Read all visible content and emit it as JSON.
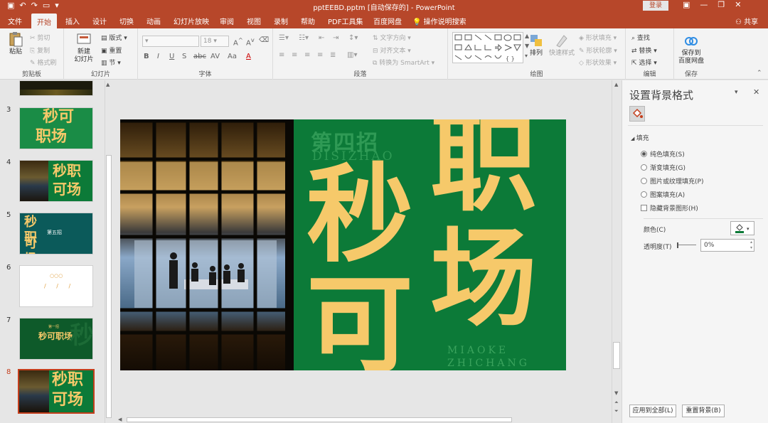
{
  "titlebar": {
    "title": "pptEEBD.pptm [自动保存的] - PowerPoint",
    "login": "登录",
    "qa_icons": [
      "save-icon",
      "undo-icon",
      "redo-icon",
      "start-slideshow-icon",
      "customize-icon"
    ],
    "window_buttons": [
      "—",
      "❐",
      "✕"
    ]
  },
  "tabs": [
    "文件",
    "开始",
    "插入",
    "设计",
    "切换",
    "动画",
    "幻灯片放映",
    "审阅",
    "视图",
    "录制",
    "帮助",
    "PDF工具集",
    "百度网盘"
  ],
  "active_tab": "开始",
  "tell_me": "操作说明搜索",
  "share": "共享",
  "ribbon": {
    "clipboard": {
      "label": "剪贴板",
      "paste": "粘贴",
      "cut": "剪切",
      "copy": "复制",
      "format_painter": "格式刷"
    },
    "slides": {
      "label": "幻灯片",
      "new_slide_1": "新建",
      "new_slide_2": "幻灯片",
      "layout": "版式",
      "reset": "重置",
      "section": "节"
    },
    "font": {
      "label": "字体",
      "size": "18",
      "bold": "B",
      "italic": "I",
      "underline": "U",
      "strike": "S",
      "shadow": "abc",
      "spacing": "AV",
      "case": "Aa",
      "color": "A"
    },
    "paragraph": {
      "label": "段落",
      "text_direction": "文字方向",
      "align_text": "对齐文本",
      "smartart": "转换为 SmartArt"
    },
    "drawing": {
      "label": "绘图",
      "arrange": "排列",
      "quick_styles": "快速样式",
      "shape_fill": "形状填充",
      "shape_outline": "形状轮廓",
      "shape_effects": "形状效果"
    },
    "editing": {
      "label": "编辑",
      "find": "查找",
      "replace": "替换",
      "select": "选择"
    },
    "save": {
      "label": "保存",
      "save_to_1": "保存到",
      "save_to_2": "百度网盘"
    }
  },
  "thumbnails": [
    {
      "num": "3",
      "text_a": "秒可",
      "text_b": "职场"
    },
    {
      "num": "4",
      "text_a": "秒职",
      "text_b": "可场"
    },
    {
      "num": "5",
      "text_a": "秒 职",
      "text_b": "可 场",
      "mid": "第五招"
    },
    {
      "num": "6",
      "text_a": "○○○",
      "text_b": "/ / /"
    },
    {
      "num": "7",
      "text_a": "秒可职场",
      "text_b": "第一招"
    },
    {
      "num": "8",
      "text_a": "秒职",
      "text_b": "可场"
    }
  ],
  "selected_slide": "8",
  "slide": {
    "heading_cn": "第四招",
    "heading_pinyin": "DISIZHAO",
    "chars": [
      "职",
      "秒",
      "场",
      "可"
    ],
    "footer_1": "MIAOKE",
    "footer_2": "ZHICHANG"
  },
  "format_panel": {
    "title": "设置背景格式",
    "section": "填充",
    "options": [
      "纯色填充(S)",
      "渐变填充(G)",
      "图片或纹理填充(P)",
      "图案填充(A)"
    ],
    "selected": "纯色填充(S)",
    "hide_bg": "隐藏背景图形(H)",
    "color_label": "颜色(C)",
    "transparency_label": "透明度(T)",
    "transparency_value": "0%",
    "apply_all": "应用到全部(L)",
    "reset_bg": "重置背景(B)"
  },
  "colors": {
    "accent": "#b7472a",
    "slide_green": "#0c7a38",
    "slide_yellow": "#f6c96a"
  }
}
